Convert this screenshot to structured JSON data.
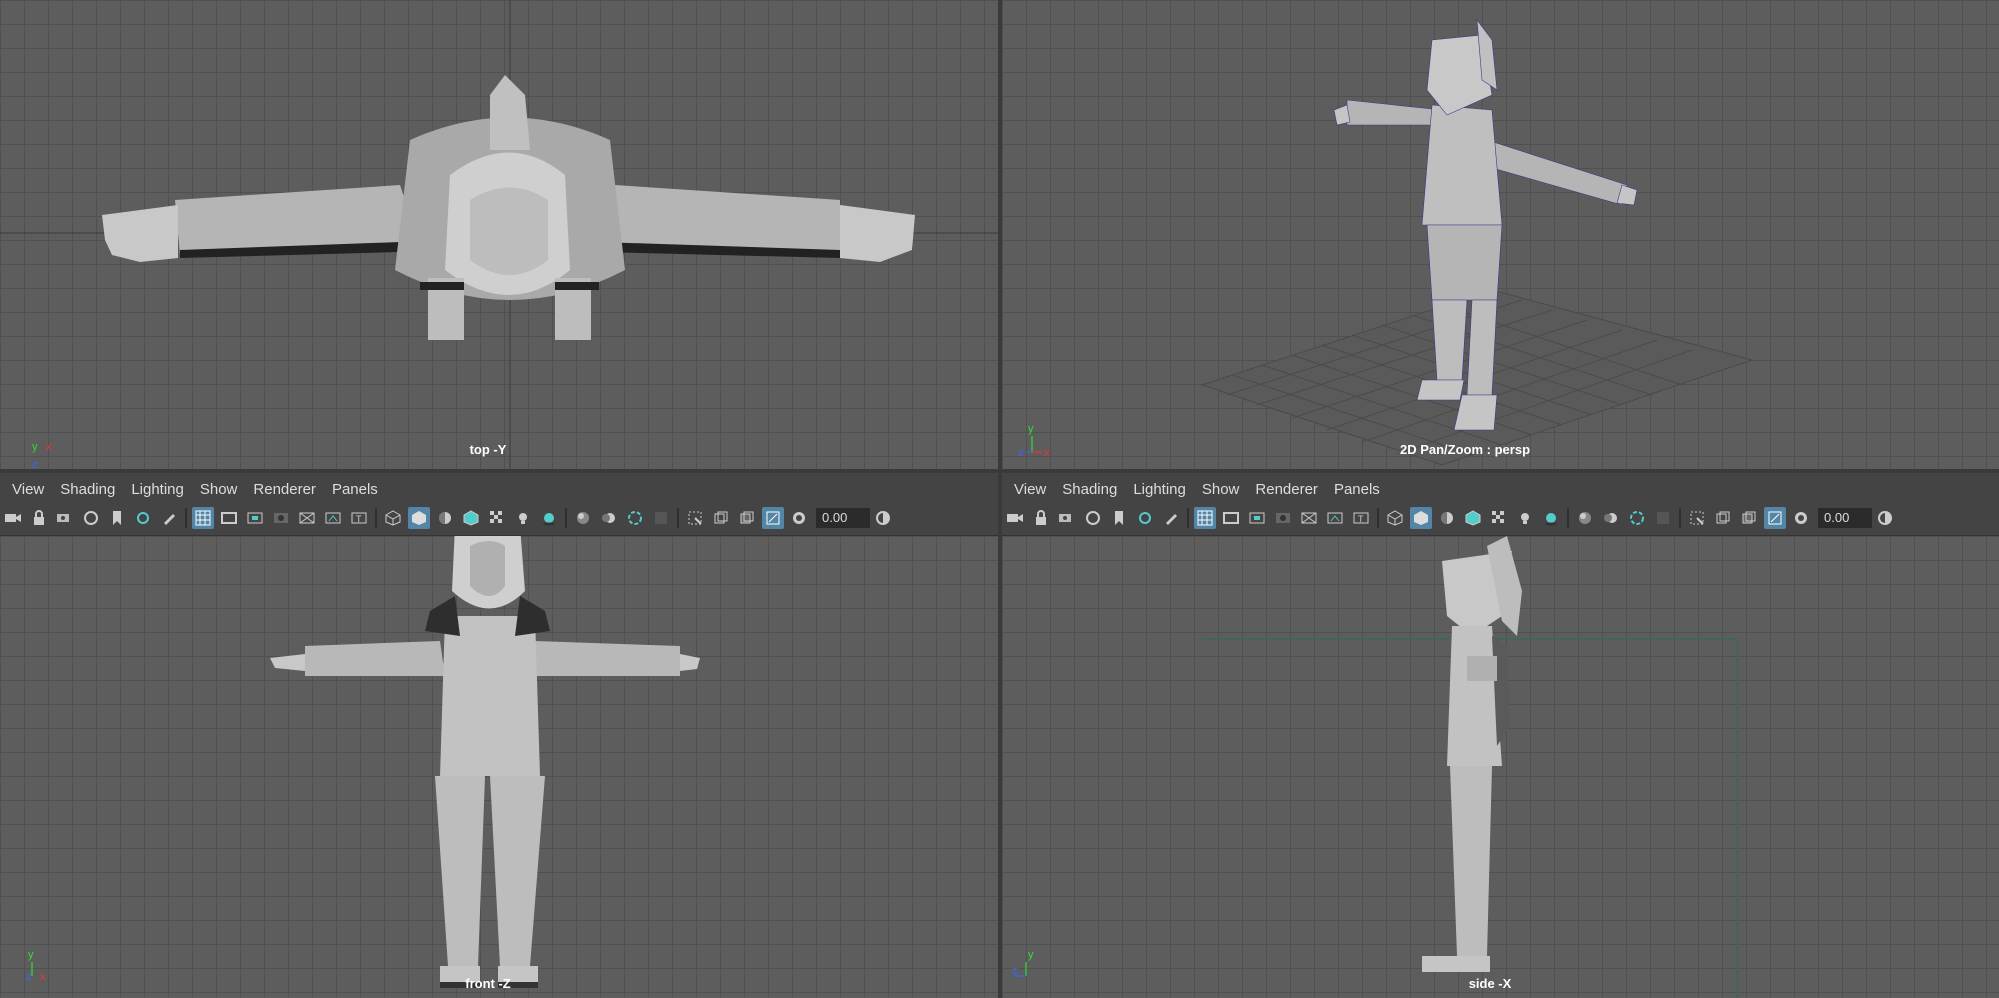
{
  "viewports": {
    "top": {
      "label": "top -Y",
      "axis": [
        "y",
        "x",
        "z"
      ]
    },
    "persp": {
      "label": "2D Pan/Zoom : persp",
      "axis": [
        "y",
        "z",
        "x"
      ]
    },
    "front": {
      "label": "front -Z",
      "axis": [
        "y",
        "z",
        "x"
      ]
    },
    "side": {
      "label": "side -X",
      "axis": [
        "y",
        "z"
      ]
    }
  },
  "panel_menu": {
    "left": [
      "View",
      "Shading",
      "Lighting",
      "Show",
      "Renderer",
      "Panels"
    ],
    "right": [
      "View",
      "Shading",
      "Lighting",
      "Show",
      "Renderer",
      "Panels"
    ]
  },
  "toolbar": {
    "exposure_value": "0.00",
    "exposure_value_right": "0.00"
  },
  "colors": {
    "accent": "#5285a6",
    "viewport_bg": "#5d5d5d",
    "grid": "#505050",
    "axis_x": "#e33",
    "axis_y": "#3d3",
    "axis_z": "#36f"
  }
}
